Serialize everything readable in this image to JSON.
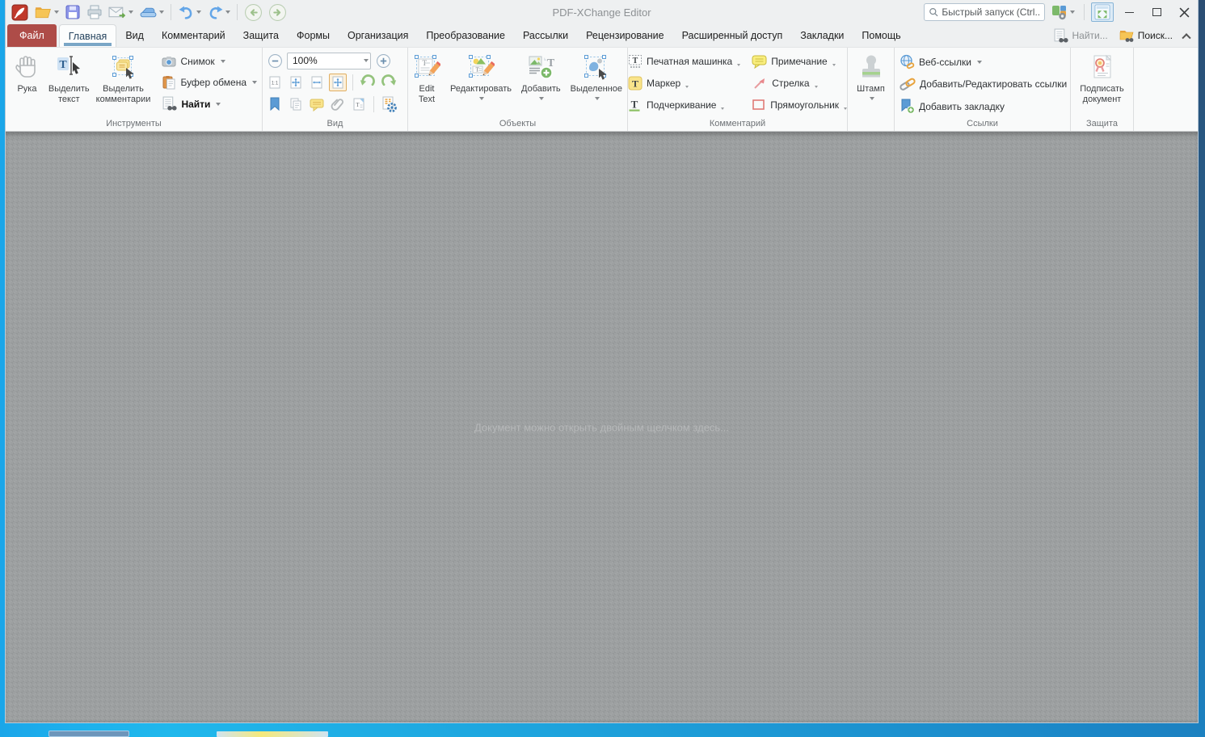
{
  "titlebar": {
    "title": "PDF-XChange Editor",
    "search_placeholder": "Быстрый запуск (Ctrl...",
    "quick_access_icons": [
      "app-logo-icon",
      "open-file-icon",
      "save-icon",
      "print-icon",
      "email-icon",
      "scan-icon",
      "undo-icon",
      "redo-icon",
      "nav-back-icon",
      "nav-forward-icon"
    ],
    "right_icons": [
      "search-icon",
      "ui-options-icon",
      "fullscreen-icon",
      "minimize-icon",
      "maximize-icon",
      "close-icon"
    ]
  },
  "tabs": {
    "file": "Файл",
    "active": "Главная",
    "items": [
      "Главная",
      "Вид",
      "Комментарий",
      "Защита",
      "Формы",
      "Организация",
      "Преобразование",
      "Рассылки",
      "Рецензирование",
      "Расширенный доступ",
      "Закладки",
      "Помощь"
    ],
    "find": "Найти...",
    "search": "Поиск..."
  },
  "ribbon": {
    "groups": {
      "tools": {
        "label": "Инструменты",
        "hand": "Рука",
        "select_text": "Выделить текст",
        "select_comments": "Выделить комментарии",
        "snapshot": "Снимок",
        "clipboard": "Буфер обмена",
        "find": "Найти"
      },
      "view": {
        "label": "Вид",
        "zoom": "100%"
      },
      "objects": {
        "label": "Объекты",
        "edit_text": "Edit Text",
        "edit": "Редактировать",
        "add": "Добавить",
        "selected": "Выделенное"
      },
      "comment": {
        "label": "Комментарий",
        "typewriter": "Печатная машинка",
        "marker": "Маркер",
        "underline": "Подчеркивание",
        "note": "Примечание",
        "arrow": "Стрелка",
        "rectangle": "Прямоугольник"
      },
      "stamp": {
        "button": "Штамп"
      },
      "links": {
        "label": "Ссылки",
        "web_links": "Веб-ссылки",
        "add_edit_links": "Добавить/Редактировать ссылки",
        "add_bookmark": "Добавить закладку"
      },
      "protect": {
        "label": "Защита",
        "sign": "Подписать документ"
      }
    }
  },
  "document": {
    "hint": "Документ можно открыть двойным щелчком здесь..."
  },
  "colors": {
    "file_tab": "#ae4c48",
    "active_tab_underline": "#7aa6c6",
    "chrome_bg": "#eef0f1",
    "ribbon_bg": "#f9fafa",
    "doc_area": "#9da0a1",
    "hint_text": "#b6b8b9",
    "desktop_dark": "#2b4d72",
    "desktop_bright": "#21c1f3"
  }
}
